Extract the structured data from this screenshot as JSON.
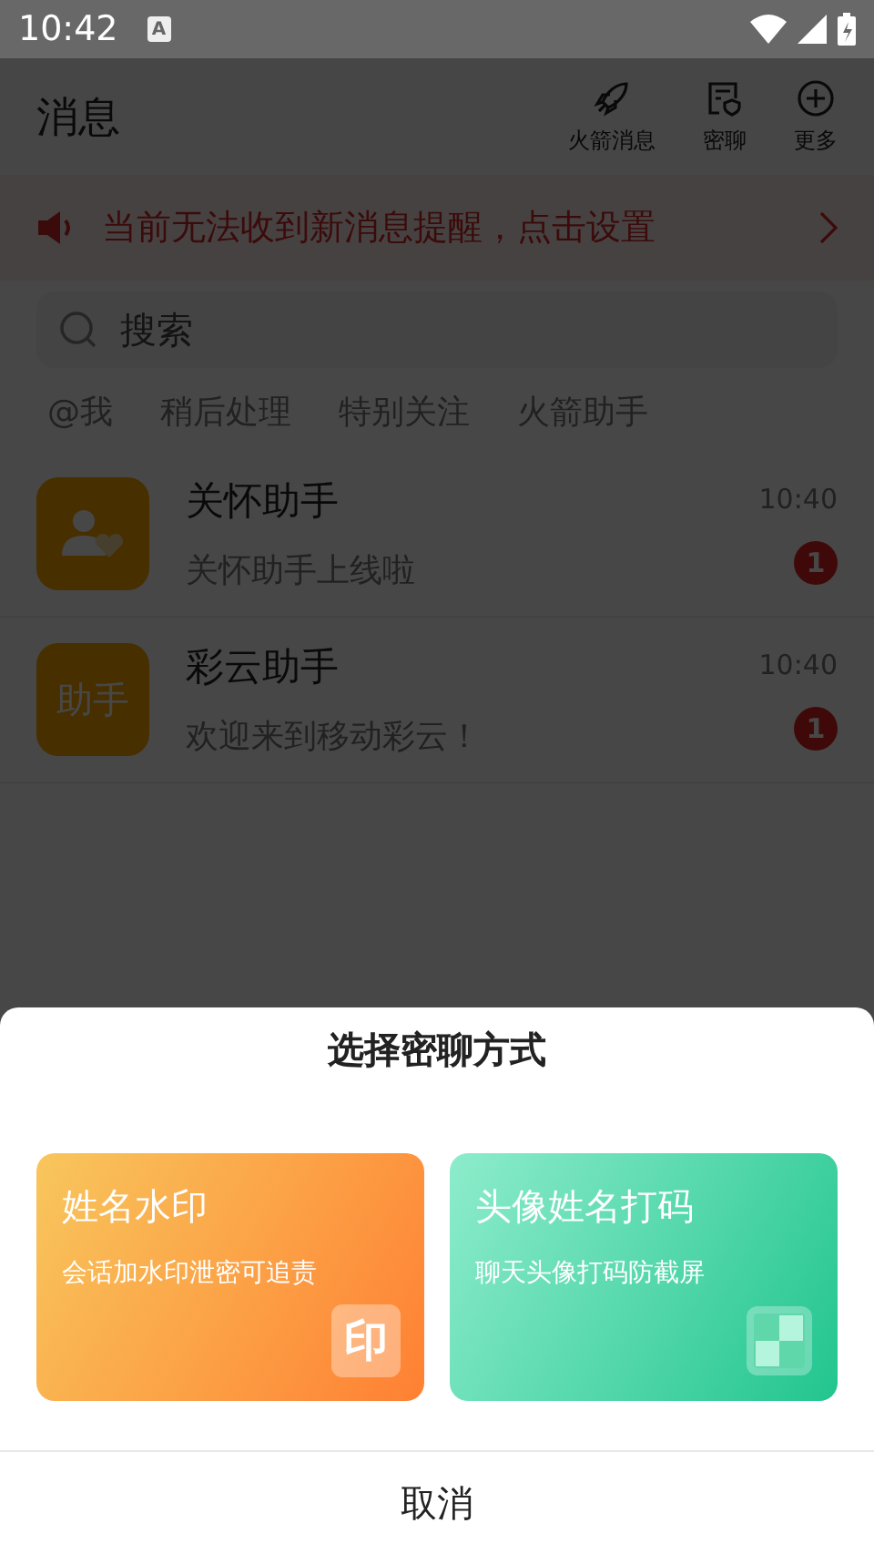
{
  "status_bar": {
    "time": "10:42",
    "notification_glyph": "A"
  },
  "header": {
    "title": "消息",
    "actions": [
      {
        "label": "火箭消息"
      },
      {
        "label": "密聊"
      },
      {
        "label": "更多"
      }
    ]
  },
  "banner": {
    "text": "当前无法收到新消息提醒，点击设置"
  },
  "search": {
    "placeholder": "搜索"
  },
  "filters": [
    "@我",
    "稍后处理",
    "特别关注",
    "火箭助手"
  ],
  "conversations": [
    {
      "name": "关怀助手",
      "preview": "关怀助手上线啦",
      "time": "10:40",
      "unread": "1",
      "avatar": {
        "kind": "icon"
      }
    },
    {
      "name": "彩云助手",
      "preview": "欢迎来到移动彩云！",
      "time": "10:40",
      "unread": "1",
      "avatar": {
        "kind": "text",
        "text": "助手"
      }
    }
  ],
  "sheet": {
    "title": "选择密聊方式",
    "options": [
      {
        "kind": "watermark",
        "title": "姓名水印",
        "subtitle": "会话加水印泄密可追责",
        "icon_glyph": "印"
      },
      {
        "kind": "mosaic",
        "title": "头像姓名打码",
        "subtitle": "聊天头像打码防截屏"
      }
    ],
    "cancel": "取消"
  }
}
